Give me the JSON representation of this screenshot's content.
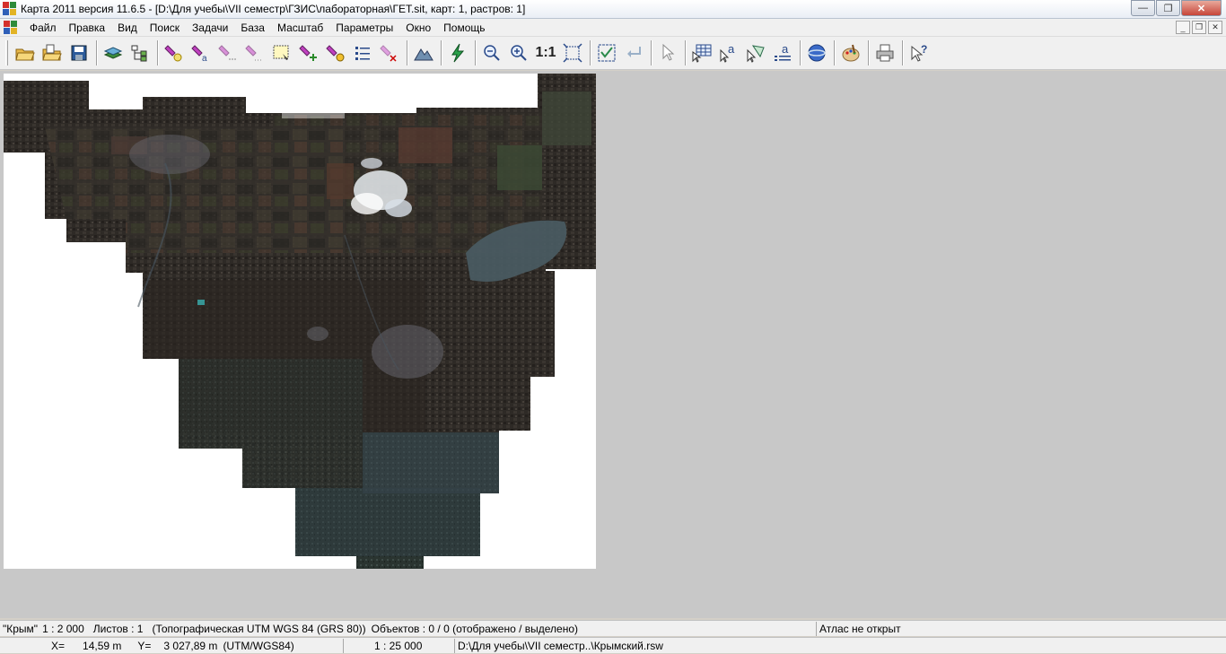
{
  "window": {
    "title": "Карта 2011 версия 11.6.5 - [D:\\Для учебы\\VII семестр\\ГЗИС\\лабораторная\\ГЕТ.sit, карт: 1, растров: 1]",
    "minimize": "—",
    "maximize": "❐",
    "close": "✕"
  },
  "menu": {
    "items": [
      "Файл",
      "Правка",
      "Вид",
      "Поиск",
      "Задачи",
      "База",
      "Масштаб",
      "Параметры",
      "Окно",
      "Помощь"
    ],
    "mdi_min": "_",
    "mdi_restore": "❐",
    "mdi_close": "✕"
  },
  "toolbar": {
    "scale_1_1": "1:1",
    "icons": [
      "open-folder-icon",
      "open-project-icon",
      "save-icon",
      "layers-icon",
      "tree-icon",
      "select-object-icon",
      "select-label-icon",
      "select-pen-icon",
      "select-multi-icon",
      "select-frame-icon",
      "select-add-icon",
      "select-query-icon",
      "list-icon",
      "clear-select-icon",
      "terrain-icon",
      "lightning-icon",
      "zoom-out-icon",
      "zoom-in-icon",
      "fit-icon",
      "check-icon",
      "return-icon",
      "pointer-icon",
      "table-icon",
      "cursor-text-icon",
      "cursor-shape-icon",
      "list-text-icon",
      "globe-icon",
      "palette-icon",
      "print-icon",
      "help-pointer-icon"
    ]
  },
  "status": {
    "map_name": "\"Крым\"",
    "map_scale": "1 : 2 000",
    "sheets": "Листов : 1",
    "projection": "(Топографическая UTM WGS 84 (GRS 80))",
    "objects": "Объектов : 0 / 0 (отображено / выделено)",
    "atlas": "Атлас не открыт",
    "x_label": "X=",
    "x_value": "14,59 m",
    "y_label": "Y=",
    "y_value": "3 027,89 m",
    "crs": "(UTM/WGS84)",
    "view_scale": "1 : 25 000",
    "raster_path": "D:\\Для учебы\\VII семестр..\\Крымский.rsw"
  }
}
